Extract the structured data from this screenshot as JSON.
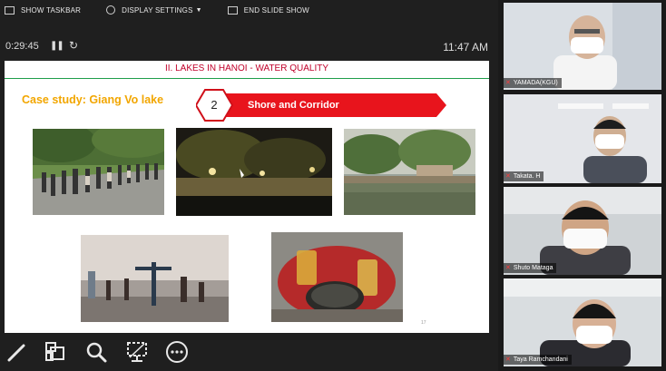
{
  "toolbar": {
    "show_taskbar": "SHOW TASKBAR",
    "display_settings": "DISPLAY SETTINGS",
    "end_slide_show": "END SLIDE SHOW"
  },
  "timer": {
    "elapsed": "0:29:45",
    "pause_glyph": "❚❚",
    "reset_glyph": "↻",
    "clock": "11:47 AM"
  },
  "slide": {
    "header": "II. LAKES IN HANOI - WATER QUALITY",
    "case_title": "Case study: Giang Vo lake",
    "badge_number": "2",
    "badge_text": "Shore and Corridor",
    "page_number": "17"
  },
  "participants": [
    {
      "name": "YAMADA(KGU)"
    },
    {
      "name": "Takata. H"
    },
    {
      "name": "Shuto Mataga"
    },
    {
      "name": "Taya Ramchandani"
    }
  ],
  "bottombar": {
    "tools": [
      "pen-icon",
      "slides-grid-icon",
      "zoom-icon",
      "pointer-screen-icon",
      "more-icon"
    ]
  },
  "colors": {
    "header_red": "#c0002a",
    "accent_orange": "#f2a600",
    "badge_red": "#e8141c"
  }
}
